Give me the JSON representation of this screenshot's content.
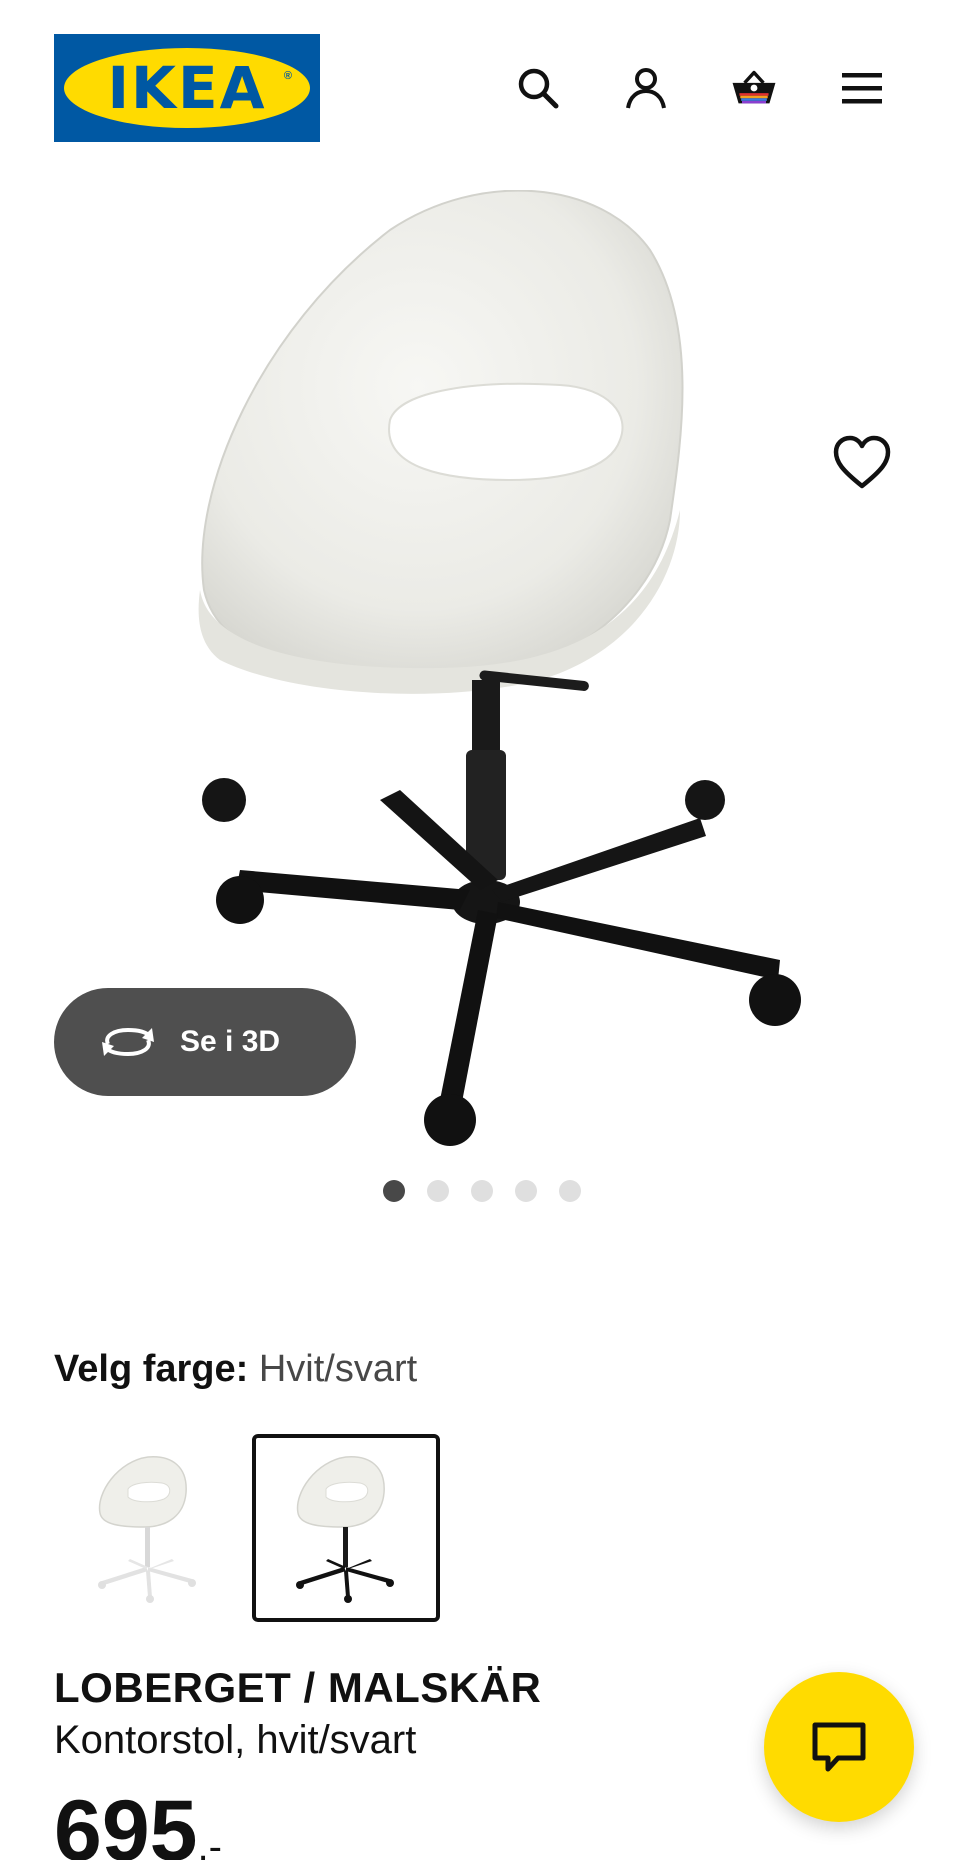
{
  "header": {
    "logo_text": "IKEA",
    "logo_reg": "®",
    "icons": [
      "search-icon",
      "account-icon",
      "basket-icon",
      "menu-icon"
    ]
  },
  "gallery": {
    "button_3d_label": "Se i 3D",
    "slide_count": 5,
    "active_slide": 1
  },
  "color_select": {
    "label": "Velg farge:",
    "value": "Hvit/svart",
    "options": [
      "Hvit",
      "Hvit/svart"
    ],
    "selected_index": 1
  },
  "product": {
    "name": "LOBERGET / MALSKÄR",
    "description": "Kontorstol, hvit/svart",
    "price_main": "695",
    "price_suffix": ",-"
  },
  "colors": {
    "ikea_blue": "#0058A3",
    "ikea_yellow": "#FFDB00",
    "chat_yellow": "#FFDB00"
  }
}
